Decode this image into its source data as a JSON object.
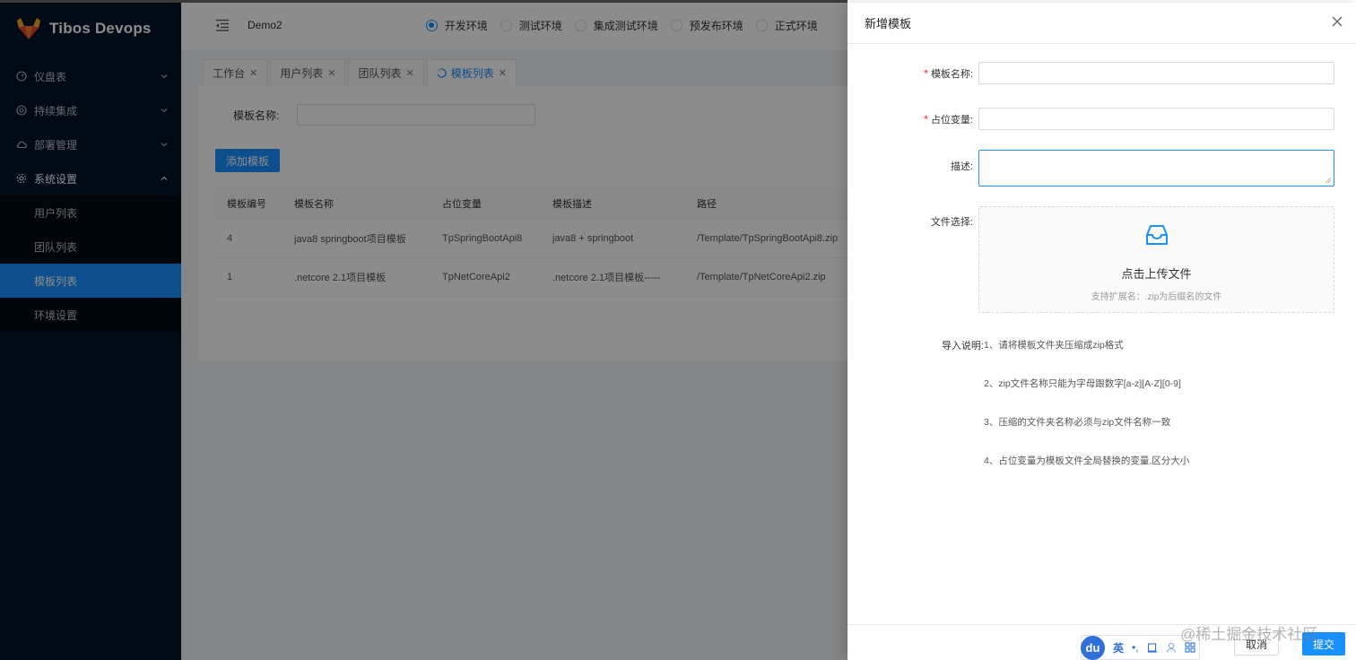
{
  "app": {
    "title": "Tibos Devops"
  },
  "sidebar": {
    "items": [
      {
        "label": "仪盘表",
        "icon": "dashboard-icon"
      },
      {
        "label": "持续集成",
        "icon": "integration-icon"
      },
      {
        "label": "部署管理",
        "icon": "cloud-icon"
      },
      {
        "label": "系统设置",
        "icon": "gear-icon"
      }
    ],
    "sub_items": [
      {
        "label": "用户列表"
      },
      {
        "label": "团队列表"
      },
      {
        "label": "模板列表",
        "active": true
      },
      {
        "label": "环境设置"
      }
    ]
  },
  "header": {
    "project": "Demo2",
    "envs": [
      {
        "label": "开发环境",
        "checked": true
      },
      {
        "label": "测试环境"
      },
      {
        "label": "集成测试环境"
      },
      {
        "label": "预发布环境"
      },
      {
        "label": "正式环境"
      }
    ]
  },
  "tabs": [
    {
      "label": "工作台"
    },
    {
      "label": "用户列表"
    },
    {
      "label": "团队列表"
    },
    {
      "label": "模板列表",
      "active": true
    }
  ],
  "search": {
    "label": "模板名称:"
  },
  "add_button": "添加模板",
  "table": {
    "headers": [
      "模板编号",
      "模板名称",
      "占位变量",
      "模板描述",
      "路径"
    ],
    "rows": [
      [
        "4",
        "java8 springboot项目模板",
        "TpSpringBootApi8",
        "java8 + springboot",
        "/Template/TpSpringBootApi8.zip"
      ],
      [
        "1",
        ".netcore 2.1项目模板",
        "TpNetCoreApi2",
        ".netcore 2.1项目模板-----",
        "/Template/TpNetCoreApi2.zip"
      ]
    ]
  },
  "drawer": {
    "title": "新增模板",
    "fields": {
      "name": "模板名称:",
      "var": "占位变量:",
      "desc": "描述:",
      "file": "文件选择:",
      "required_mark": "*"
    },
    "upload": {
      "text": "点击上传文件",
      "hint": "支持扩展名：.zip为后缀名的文件"
    },
    "notes_label": "导入说明:",
    "notes": [
      "1、请将模板文件夹压缩成zip格式",
      "2、zip文件名称只能为字母跟数字[a-z][A-Z][0-9]",
      "3、压缩的文件夹名称必须与zip文件名称一致",
      "4、占位变量为模板文件全局替换的变量,区分大小"
    ],
    "cancel": "取消",
    "submit": "提交"
  },
  "ime": {
    "logo": "du",
    "lang": "英",
    "punct": "•,",
    "items": [
      "cup-icon",
      "user-icon",
      "grid-icon"
    ]
  },
  "watermark": "@稀土掘金技术社区",
  "colors": {
    "primary": "#1890ff",
    "sider": "#001529",
    "required": "#f5222d"
  }
}
